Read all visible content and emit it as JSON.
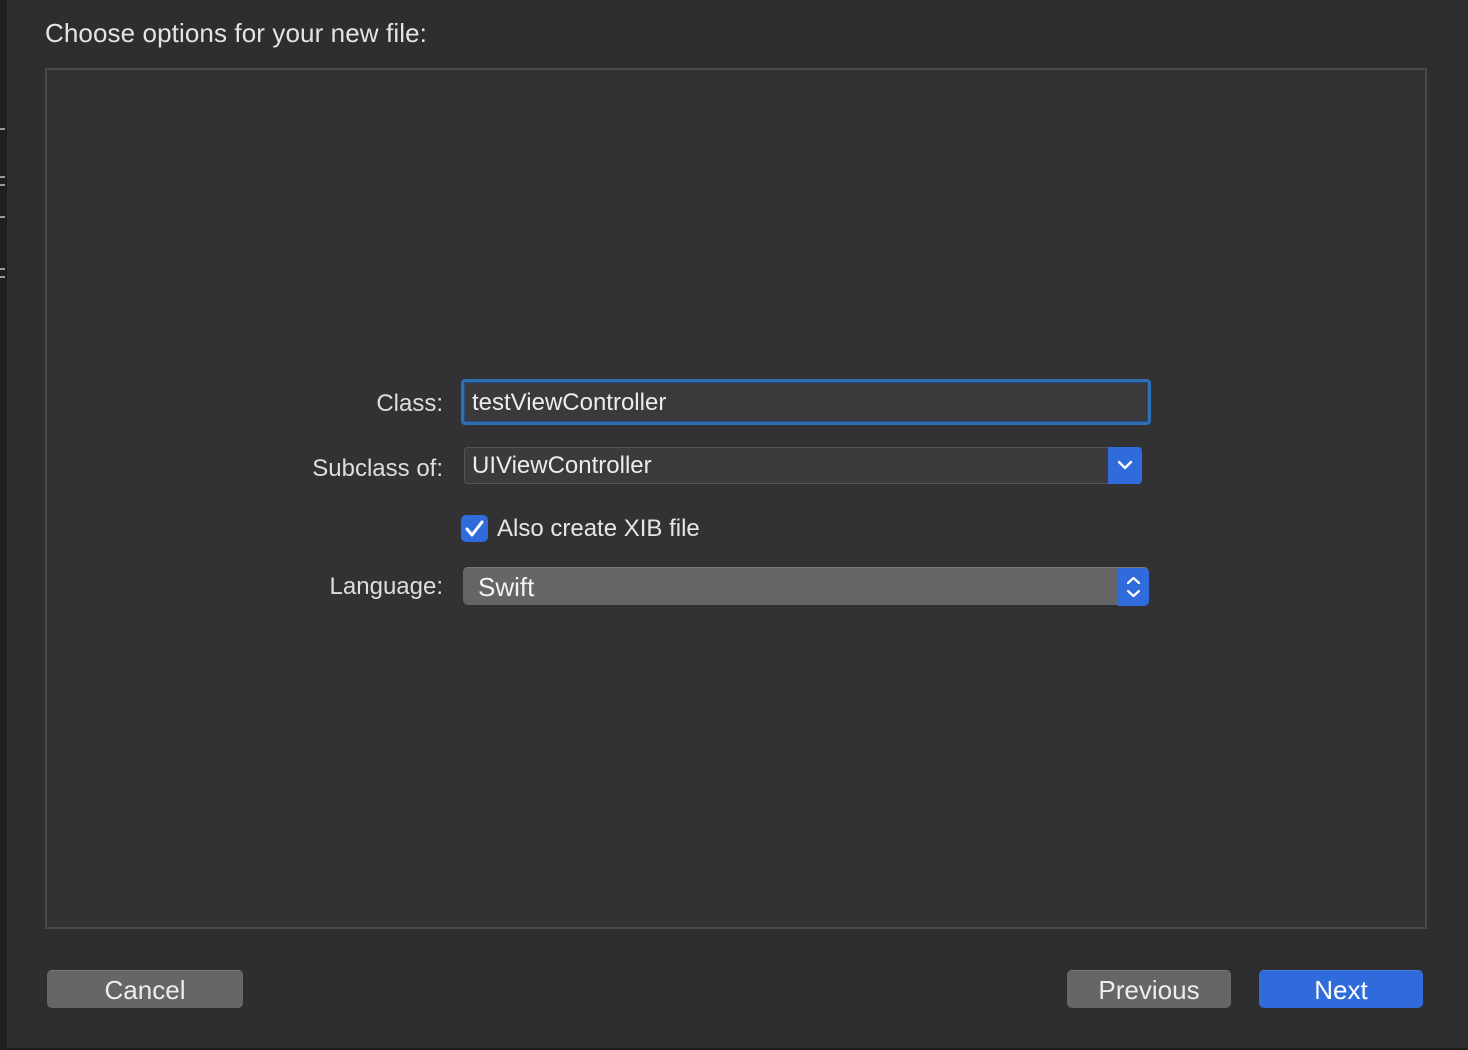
{
  "dialog": {
    "title": "Choose options for your new file:"
  },
  "form": {
    "class_label": "Class:",
    "class_value": "testViewController",
    "subclass_label": "Subclass of:",
    "subclass_value": "UIViewController",
    "xib_checkbox_label": "Also create XIB file",
    "xib_checked": true,
    "language_label": "Language:",
    "language_value": "Swift"
  },
  "buttons": {
    "cancel": "Cancel",
    "previous": "Previous",
    "next": "Next"
  },
  "icons": {
    "combo_arrow": "chevron-down-icon",
    "popup_arrows": "up-down-chevron-icon",
    "checkbox": "checkmark-icon"
  },
  "colors": {
    "accent": "#2f6bdb",
    "focus_ring": "#2f6fb4",
    "background": "#2e2e30"
  }
}
